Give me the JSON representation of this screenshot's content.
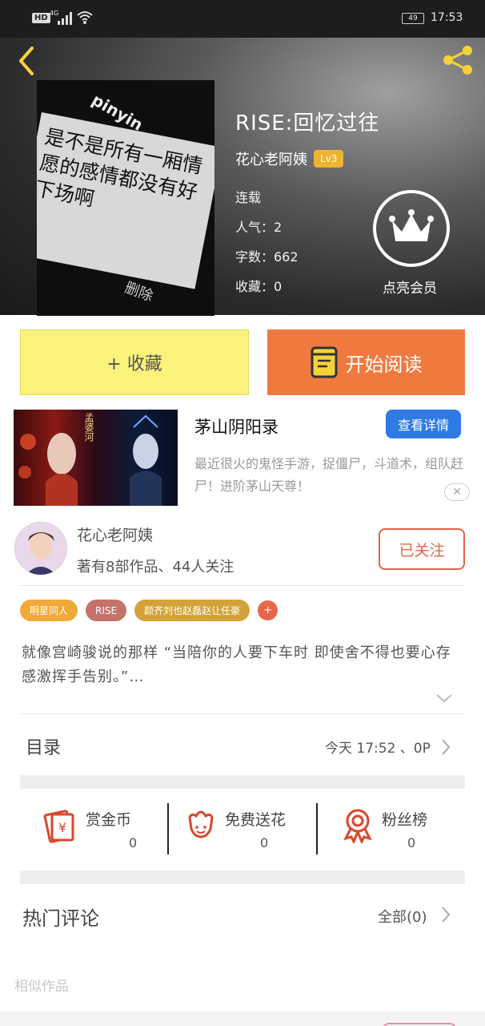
{
  "status_bar": {
    "hd": "HD",
    "network": "4G",
    "battery": "49",
    "time": "17:53"
  },
  "book": {
    "cover_text_lines": [
      "是不是所有一厢情",
      "愿的感情都没有好",
      "下场啊"
    ],
    "cover_pinyin": "pinyin",
    "cover_bottom": "删除",
    "title": "RISE:回忆过往",
    "author": "花心老阿姨",
    "level": "Lv3",
    "status": "连载",
    "popularity": "人气：2",
    "word_count": "字数：662",
    "favorites": "收藏：0",
    "vip_label": "点亮会员"
  },
  "actions": {
    "collect_label": "+ 收藏",
    "read_label": "开始阅读"
  },
  "ad": {
    "title": "茅山阴阳录",
    "button_label": "查看详情",
    "description": "最近很火的鬼怪手游，捉僵尸，斗道术，组队赶尸！进阶茅山天尊！",
    "image_caption": "孟婆河",
    "close": "✕"
  },
  "author_section": {
    "name": "花心老阿姨",
    "stats": "著有8部作品、44人关注",
    "follow_label": "已关注"
  },
  "tags": [
    {
      "label": "明星同人",
      "color": "#f0a93a"
    },
    {
      "label": "RISE",
      "color": "#c4736a"
    },
    {
      "label": "颜齐刘也赵磊赵让任豪",
      "color": "#d4a23a"
    }
  ],
  "tag_add": "+",
  "synopsis": "就像宫崎骏说的那样 “当陪你的人要下车时 即使舍不得也要心存感激挥手告别。”…",
  "toc": {
    "label": "目录",
    "latest": "今天 17:52 、0P"
  },
  "stats": {
    "reward": {
      "label": "赏金币",
      "value": "0"
    },
    "flower": {
      "label": "免费送花",
      "value": "0"
    },
    "fans": {
      "label": "粉丝榜",
      "value": "0"
    }
  },
  "comments": {
    "title": "热门评论",
    "all": "全部(0)"
  },
  "similar_label": "相似作品",
  "colors": {
    "accent_orange": "#f07a3e",
    "collect_yellow": "#fbf27b",
    "ad_blue": "#2f7ae5",
    "icon_red": "#d9472b"
  }
}
